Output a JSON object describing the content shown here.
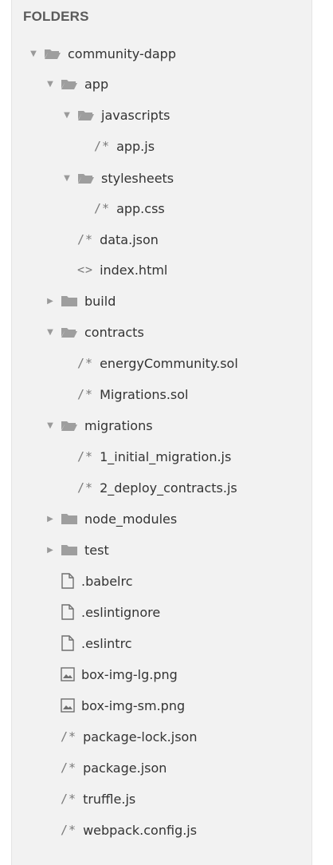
{
  "sidebar": {
    "title": "FOLDERS",
    "items": [
      {
        "label": "community-dapp",
        "kind": "folder",
        "expanded": true
      },
      {
        "label": "app",
        "kind": "folder",
        "expanded": true
      },
      {
        "label": "javascripts",
        "kind": "folder",
        "expanded": true
      },
      {
        "label": "app.js",
        "kind": "code-file",
        "glyph": "/*"
      },
      {
        "label": "stylesheets",
        "kind": "folder",
        "expanded": true
      },
      {
        "label": "app.css",
        "kind": "code-file",
        "glyph": "/*"
      },
      {
        "label": "data.json",
        "kind": "code-file",
        "glyph": "/*"
      },
      {
        "label": "index.html",
        "kind": "markup-file",
        "glyph": "<>"
      },
      {
        "label": "build",
        "kind": "folder",
        "expanded": false
      },
      {
        "label": "contracts",
        "kind": "folder",
        "expanded": true
      },
      {
        "label": "energyCommunity.sol",
        "kind": "code-file",
        "glyph": "/*"
      },
      {
        "label": "Migrations.sol",
        "kind": "code-file",
        "glyph": "/*"
      },
      {
        "label": "migrations",
        "kind": "folder",
        "expanded": true
      },
      {
        "label": "1_initial_migration.js",
        "kind": "code-file",
        "glyph": "/*"
      },
      {
        "label": "2_deploy_contracts.js",
        "kind": "code-file",
        "glyph": "/*"
      },
      {
        "label": "node_modules",
        "kind": "folder",
        "expanded": false
      },
      {
        "label": "test",
        "kind": "folder",
        "expanded": false
      },
      {
        "label": ".babelrc",
        "kind": "plain-file"
      },
      {
        "label": ".eslintignore",
        "kind": "plain-file"
      },
      {
        "label": ".eslintrc",
        "kind": "plain-file"
      },
      {
        "label": "box-img-lg.png",
        "kind": "image-file"
      },
      {
        "label": "box-img-sm.png",
        "kind": "image-file"
      },
      {
        "label": "package-lock.json",
        "kind": "code-file",
        "glyph": "/*"
      },
      {
        "label": "package.json",
        "kind": "code-file",
        "glyph": "/*"
      },
      {
        "label": "truffle.js",
        "kind": "code-file",
        "glyph": "/*"
      },
      {
        "label": "webpack.config.js",
        "kind": "code-file",
        "glyph": "/*"
      }
    ]
  },
  "colors": {
    "panel_background": "#f2f2f2",
    "folder_icon": "#9e9e9e",
    "text": "#333333"
  }
}
